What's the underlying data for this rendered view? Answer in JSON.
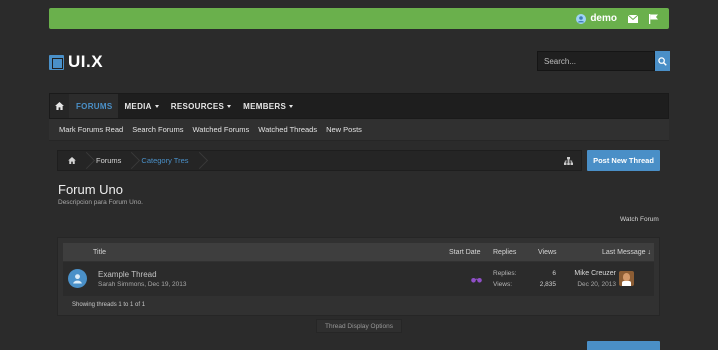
{
  "topbar": {
    "username": "demo",
    "color": "#6ab04c"
  },
  "logo": {
    "text": "UI.X"
  },
  "search": {
    "placeholder": "Search..."
  },
  "nav": {
    "items": [
      {
        "label": "FORUMS",
        "active": true
      },
      {
        "label": "MEDIA",
        "caret": true
      },
      {
        "label": "RESOURCES",
        "caret": true
      },
      {
        "label": "MEMBERS",
        "caret": true
      }
    ]
  },
  "subnav": [
    "Mark Forums Read",
    "Search Forums",
    "Watched Forums",
    "Watched Threads",
    "New Posts"
  ],
  "breadcrumb": {
    "items": [
      "Forums",
      "Category Tres"
    ]
  },
  "buttons": {
    "post_new_thread": "Post New Thread",
    "display_options": "Thread Display Options",
    "watch_forum": "Watch Forum"
  },
  "forum": {
    "title": "Forum Uno",
    "description": "Descripcion para Forum Uno."
  },
  "table": {
    "headers": {
      "title": "Title",
      "start_date": "Start Date",
      "replies": "Replies",
      "views": "Views",
      "last_message": "Last Message ↓"
    },
    "rows": [
      {
        "title": "Example Thread",
        "author_date": "Sarah Simmons, Dec 19, 2013",
        "replies_label": "Replies:",
        "replies": "6",
        "views_label": "Views:",
        "views": "2,835",
        "last_user": "Mike Creuzer",
        "last_date": "Dec 20, 2013"
      }
    ],
    "footer": "Showing threads 1 to 1 of 1"
  },
  "colors": {
    "accent": "#4a8fc7",
    "background": "#2b2b2b"
  }
}
